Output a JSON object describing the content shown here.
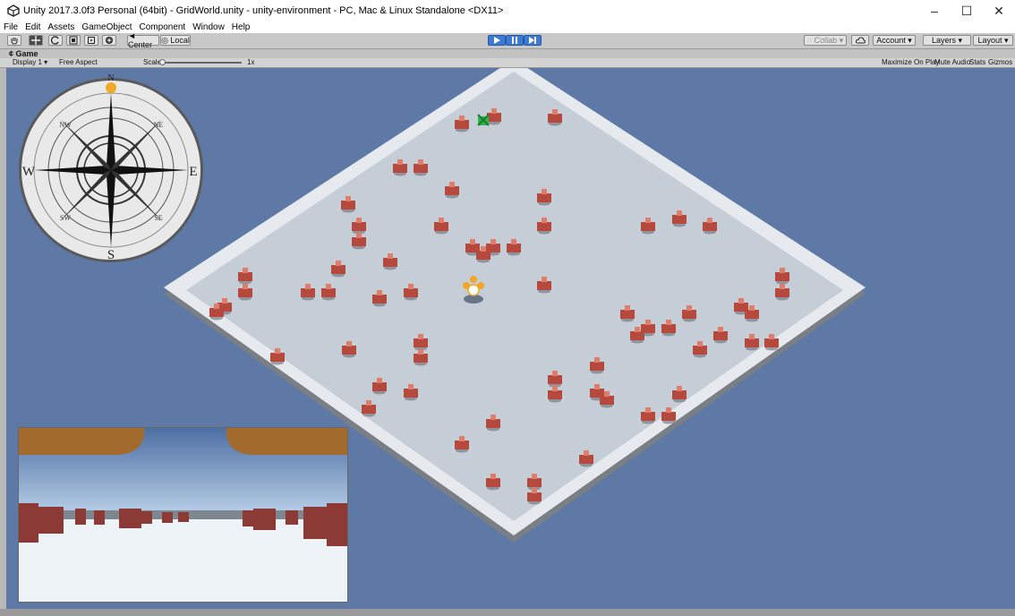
{
  "window": {
    "title": "Unity 2017.3.0f3 Personal (64bit) - GridWorld.unity - unity-environment - PC, Mac & Linux Standalone <DX11>",
    "minimize": "–",
    "maximize": "☐",
    "close": "✕"
  },
  "menu": [
    "File",
    "Edit",
    "Assets",
    "GameObject",
    "Component",
    "Window",
    "Help"
  ],
  "toolbar": {
    "center_label": "◄ Center",
    "local_label": "◎ Local",
    "collab_label": "◌ Collab ▾",
    "account_label": "Account ▾",
    "layers_label": "Layers ▾",
    "layout_label": "Layout ▾"
  },
  "game_tab": {
    "label": "¢ Game",
    "display": "Display 1 ▾",
    "aspect": "Free Aspect",
    "scale_label": "Scale",
    "scale_value": "1x",
    "maximize_on_play": "Maximize On Play",
    "mute_audio": "Mute Audio",
    "stats": "Stats",
    "gizmos": "Gizmos ▾"
  },
  "compass": {
    "n": "N",
    "s": "S",
    "e": "E",
    "w": "W",
    "ne": "NE",
    "nw": "NW",
    "se": "SE",
    "sw": "SW"
  },
  "colors": {
    "sky": "#5e79a6",
    "floor": "#c5cdd6",
    "wall": "#e6e9ed",
    "obstacle": "#b5493d",
    "goal": "#2fb34a",
    "agent": "#f2a826"
  }
}
